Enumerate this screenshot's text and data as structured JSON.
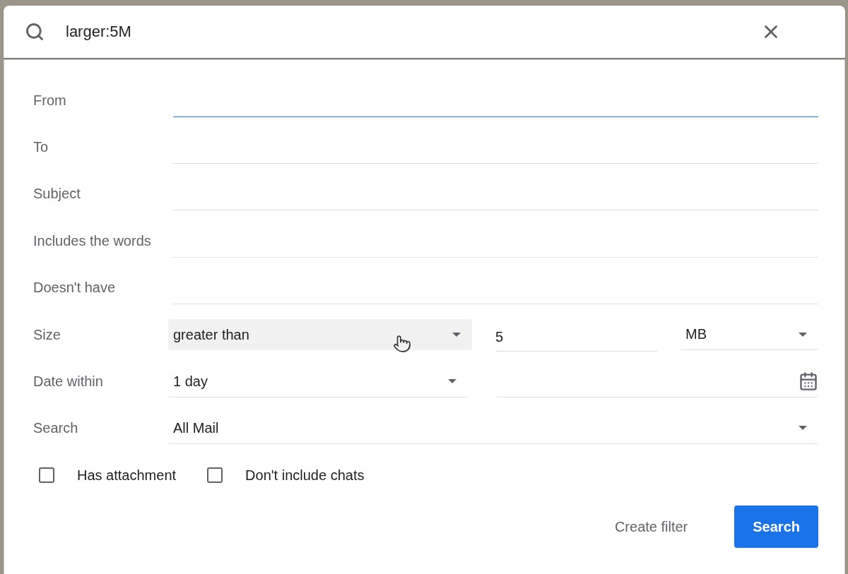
{
  "search_bar": {
    "value": "larger:5M"
  },
  "rows": [
    {
      "kind": "text",
      "label": "From",
      "value": "",
      "focused": true
    },
    {
      "kind": "text",
      "label": "To",
      "value": "",
      "focused": false
    },
    {
      "kind": "text",
      "label": "Subject",
      "value": "",
      "focused": false
    },
    {
      "kind": "text",
      "label": "Includes the words",
      "value": "",
      "focused": false
    },
    {
      "kind": "text",
      "label": "Doesn't have",
      "value": "",
      "focused": false
    },
    {
      "kind": "size",
      "label": "Size",
      "comparison": {
        "value": "greater than",
        "hovered": true
      },
      "amount": "5",
      "unit": "MB"
    },
    {
      "kind": "date",
      "label": "Date within",
      "value": "1 day"
    },
    {
      "kind": "select",
      "label": "Search",
      "value": "All Mail"
    }
  ],
  "checkboxes": [
    {
      "label": "Has attachment",
      "checked": false
    },
    {
      "label": "Don't include chats",
      "checked": false
    }
  ],
  "buttons": [
    {
      "kind": "text",
      "label": "Create filter"
    },
    {
      "kind": "primary",
      "label": "Search"
    }
  ]
}
